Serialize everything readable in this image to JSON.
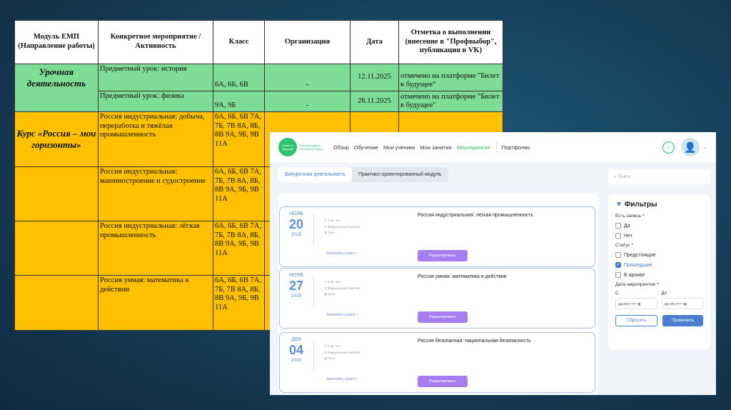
{
  "table": {
    "headers": [
      "Модуль ЕМП (Направление работы)",
      "Конкретное мероприятие / Активность",
      "Класс",
      "Организация",
      "Дата",
      "Отметка о выполнении (внесение в \"Профвыбор\", публикация в VK)"
    ],
    "rows": [
      {
        "module": "Урочная деятельность",
        "activity": "Предметный урок: история",
        "classes": "6А, 6Б, 6В",
        "org": "-",
        "date": "12.11.2025",
        "mark": "отмечено на платформе \"Билет в будущее\""
      },
      {
        "module": "",
        "activity": "Предметный урок: физика",
        "classes": "9А, 9Б",
        "org": "-",
        "date": "26.11.2025",
        "mark": "отмечено на платформе \"Билет в будущее\""
      },
      {
        "module": "Курс «Россия – мои горизонты»",
        "activity": "Россия индустриальная: добыча, переработка и тяжёлая промышленность",
        "classes": "6А, 6Б, 6В 7А, 7Б, 7В 8А, 8Б, 8В 9А, 9Б, 9В 11А",
        "org": "",
        "date": "",
        "mark": ""
      },
      {
        "module": "",
        "activity": "Россия индустриальная: машиностроение и судостроение",
        "classes": "6А, 6Б, 6В 7А, 7Б, 7В 8А, 8Б, 8В 9А, 9Б, 9В 11А",
        "org": "",
        "date": "",
        "mark": ""
      },
      {
        "module": "",
        "activity": "Россия индустриальная: лёгкая промышленность",
        "classes": "6А, 6Б, 6В 7А, 7Б, 7В 8А, 8Б, 8В 9А, 9Б, 9В 11А",
        "org": "",
        "date": "",
        "mark": ""
      },
      {
        "module": "",
        "activity": "Россия умная: математика в действии",
        "classes": "6А, 6Б, 6В 7А, 7Б, 7В 8А, 8Б, 8В 9А, 9Б, 9В 11А",
        "org": "",
        "date": "",
        "mark": ""
      }
    ]
  },
  "app": {
    "logo": "Билет в будущее",
    "logo_sub": "Единая модель профориентации",
    "nav": [
      "Обзор",
      "Обучение",
      "Мои ученики",
      "Мои занятия",
      "Мероприятия",
      "Портфолио"
    ],
    "tabs": [
      "Внеурочная деятельность",
      "Практико-ориентированный модуль"
    ],
    "search_placeholder": "Поиск",
    "cards": [
      {
        "month": "НОЯБ",
        "day": "20",
        "year": "2025",
        "meta": [
          "1 ак. час",
          "Федеральное занятие",
          "Урок"
        ],
        "title": "Россия индустриальная: легкая промышленность",
        "fill": "Заполнить анкету ›",
        "edit": "Редактировать"
      },
      {
        "month": "НОЯБ",
        "day": "27",
        "year": "2025",
        "meta": [
          "1 ак. час",
          "Федеральное занятие",
          "Урок"
        ],
        "title": "Россия умная: математика в действии",
        "fill": "Заполнить анкету ›",
        "edit": "Редактировать"
      },
      {
        "month": "ДЕК",
        "day": "04",
        "year": "2025",
        "meta": [
          "1 ак. час",
          "Федеральное занятие",
          "Урок"
        ],
        "title": "Россия безопасная: национальная безопасность",
        "fill": "Заполнить анкету ›",
        "edit": "Редактировать"
      }
    ],
    "filters": {
      "title": "Фильтры",
      "has_record": "Есть запись ^",
      "yes": "Да",
      "no": "Нет",
      "status": "Статус ^",
      "upcoming": "Предстоящие",
      "past": "Прошедшие",
      "archive": "В архиве",
      "date": "Дата мероприятия ^",
      "from": "С",
      "to": "До",
      "date_ph": "ДД.ММ.ГГГГ",
      "reset": "Сбросить",
      "apply": "Применить"
    }
  }
}
